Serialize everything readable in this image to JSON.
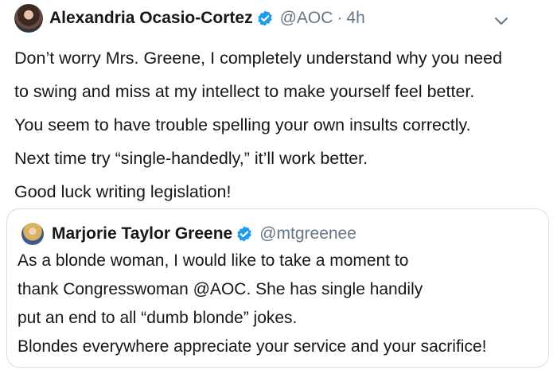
{
  "tweet": {
    "author": {
      "name": "Alexandria Ocasio-Cortez",
      "handle": "@AOC",
      "separator": "·",
      "time": "4h"
    },
    "text_lines": [
      "Don’t worry Mrs. Greene, I completely understand why you need",
      "to swing and miss at my intellect to make yourself feel better.",
      "You seem to have trouble spelling your own insults correctly.",
      "Next time try “single-handedly,” it’ll work better.",
      "Good luck writing legislation!"
    ]
  },
  "quoted_tweet": {
    "author": {
      "name": "Marjorie Taylor Greene",
      "handle": "@mtgreenee"
    },
    "text_lines": [
      "As a blonde woman, I would like to take a moment to",
      "thank Congresswoman @AOC.  She has single handily",
      "put an end to all “dumb blonde” jokes.",
      "Blondes everywhere appreciate your service and your sacrifice!"
    ]
  },
  "colors": {
    "verified_badge": "#1d9bf0",
    "secondary_text": "#657786",
    "border": "#d8dee3"
  },
  "icons": {
    "verified": "verified-badge-icon",
    "menu": "chevron-down-icon"
  }
}
